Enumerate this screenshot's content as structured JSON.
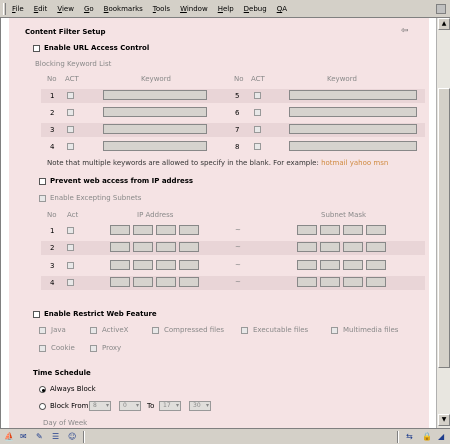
{
  "menu": [
    "File",
    "Edit",
    "View",
    "Go",
    "Bookmarks",
    "Tools",
    "Window",
    "Help",
    "Debug",
    "QA"
  ],
  "page": {
    "title": "Content Filter Setup",
    "url_access": {
      "label": "Enable URL Access Control",
      "list_title": "Blocking Keyword List",
      "headers": {
        "no": "No",
        "act": "ACT",
        "keyword": "Keyword"
      },
      "rows_left": [
        "1",
        "2",
        "3",
        "4"
      ],
      "rows_right": [
        "5",
        "6",
        "7",
        "8"
      ],
      "note": "Note that multiple keywords are allowed to specify in the blank. For example:",
      "note_example": "hotmail yahoo msn"
    },
    "ip_block": {
      "label": "Prevent web access from IP address",
      "except_label": "Enable Excepting Subnets",
      "headers": {
        "no": "No",
        "act": "Act",
        "ip": "IP Address",
        "mask": "Subnet Mask"
      },
      "rows": [
        "1",
        "2",
        "3",
        "4"
      ],
      "separator": "~"
    },
    "restrict": {
      "label": "Enable Restrict Web Feature",
      "features": [
        "Java",
        "ActiveX",
        "Compressed files",
        "Executable files",
        "Multimedia files",
        "Cookie",
        "Proxy"
      ]
    },
    "schedule": {
      "title": "Time Schedule",
      "always": "Always Block",
      "block_from": "Block From",
      "from_h": "8",
      "from_m": "0",
      "to": "To",
      "to_h": "17",
      "to_m": "30",
      "dow": "Day of Week"
    }
  }
}
